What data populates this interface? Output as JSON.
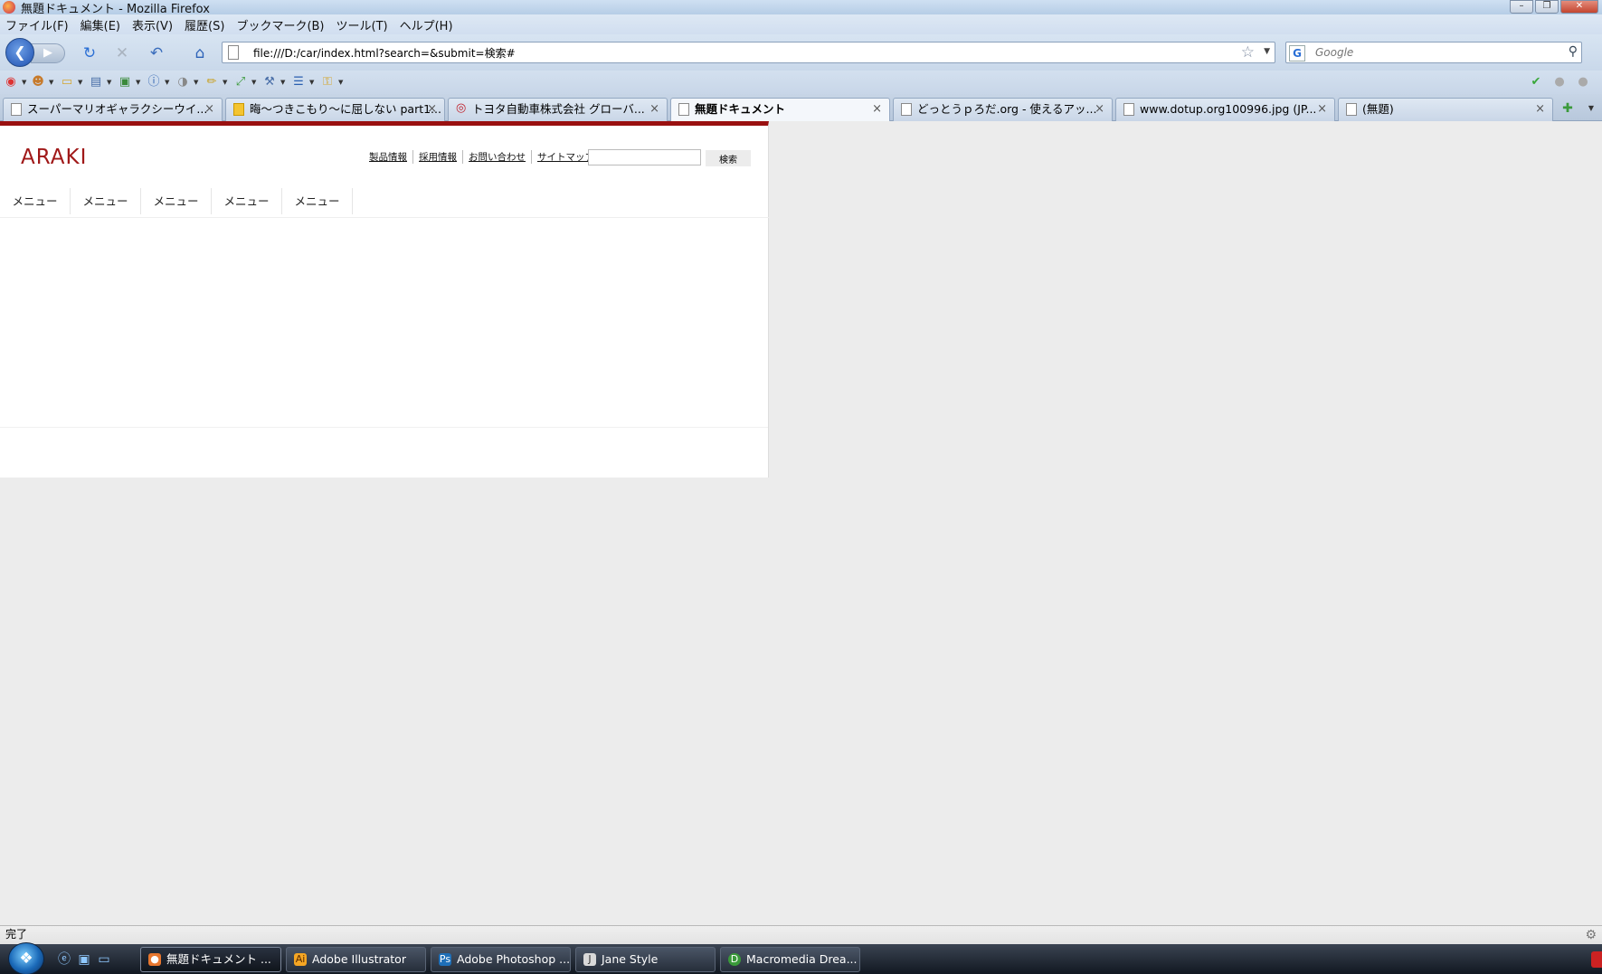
{
  "window": {
    "title": "無題ドキュメント - Mozilla Firefox",
    "minimize": "–",
    "restore": "❐",
    "close": "✕"
  },
  "menu": [
    "ファイル(F)",
    "編集(E)",
    "表示(V)",
    "履歴(S)",
    "ブックマーク(B)",
    "ツール(T)",
    "ヘルプ(H)"
  ],
  "nav": {
    "url": "file:///D:/car/index.html?search=&submit=検索#",
    "search_placeholder": "Google"
  },
  "tabs": [
    {
      "label": "スーパーマリオギャラクシーウイ...",
      "active": false
    },
    {
      "label": "晦～つきこもり～に屈しない part1...",
      "active": false
    },
    {
      "label": "トヨタ自動車株式会社 グローバ...",
      "active": false
    },
    {
      "label": "無題ドキュメント",
      "active": true
    },
    {
      "label": "どっとうｐろだ.org - 使えるアッ...",
      "active": false
    },
    {
      "label": "www.dotup.org100996.jpg (JP...",
      "active": false
    },
    {
      "label": "(無題)",
      "active": false
    }
  ],
  "page": {
    "logo": "ARAKI",
    "util_links": [
      "製品情報",
      "採用情報",
      "お問い合わせ",
      "サイトマップ"
    ],
    "search_button": "検索",
    "nav_items": [
      "メニュー",
      "メニュー",
      "メニュー",
      "メニュー",
      "メニュー"
    ]
  },
  "status": {
    "text": "完了"
  },
  "taskbar": {
    "items": [
      {
        "label": "無題ドキュメント ...",
        "active": true
      },
      {
        "label": "Adobe Illustrator",
        "active": false
      },
      {
        "label": "Adobe Photoshop ...",
        "active": false
      },
      {
        "label": "Jane Style",
        "active": false
      },
      {
        "label": "Macromedia Drea...",
        "active": false
      }
    ]
  },
  "colors": {
    "brand_red": "#a01818",
    "top_border": "#9a1010"
  }
}
